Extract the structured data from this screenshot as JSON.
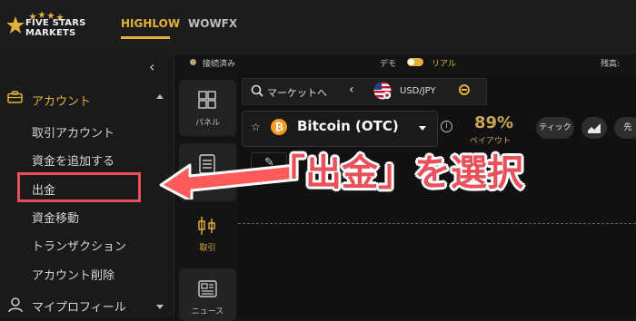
{
  "brand": {
    "line1": "FIVE STARS",
    "line2": "MARKETS"
  },
  "nav": {
    "tabs": [
      {
        "label": "HIGHLOW"
      },
      {
        "label": "WOWFX"
      }
    ]
  },
  "sidebar": {
    "section": "アカウント",
    "items": [
      {
        "label": "取引アカウント"
      },
      {
        "label": "資金を追加する"
      },
      {
        "label": "出金"
      },
      {
        "label": "資金移動"
      },
      {
        "label": "トランザクション"
      },
      {
        "label": "アカウント削除"
      }
    ],
    "profile": "マイプロフィール"
  },
  "icon_panel": [
    {
      "label": "パネル"
    },
    {
      "label": "取引"
    },
    {
      "label": "ニュース"
    }
  ],
  "status": {
    "connection": "接続済み",
    "demo": "デモ",
    "real": "リアル",
    "balance": "残高:"
  },
  "market": {
    "button": "マーケットへ",
    "pair": "USD/JPY"
  },
  "asset": {
    "name": "Bitcoin (OTC)",
    "payout_value": "89%",
    "payout_label": "ペイアウト"
  },
  "toolbar": {
    "tick": "ティック",
    "next": "先"
  },
  "annotation": {
    "text": "「出金」を選択"
  },
  "colors": {
    "accent": "#e3b23a",
    "annotation": "#e8505b",
    "bitcoin": "#f39a1f"
  }
}
